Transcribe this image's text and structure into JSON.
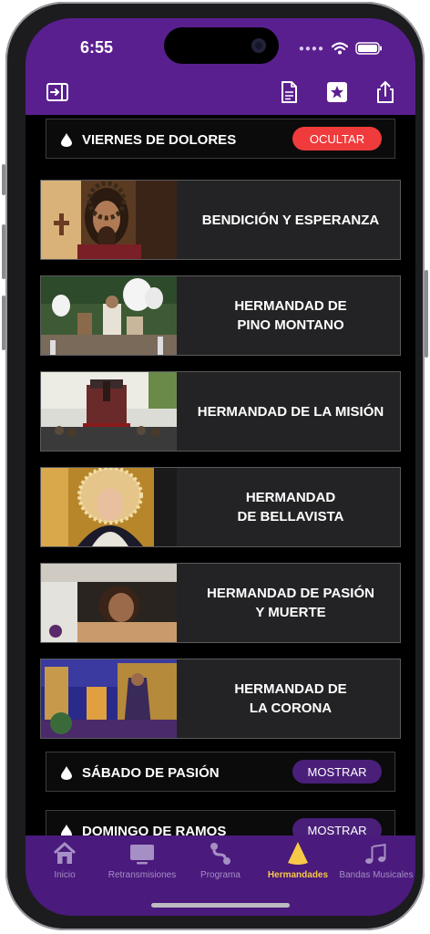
{
  "status": {
    "time": "6:55"
  },
  "toolbar": {
    "sidebar_icon": "sidebar-toggle-icon",
    "document_icon": "document-icon",
    "favorites_icon": "star-square-icon",
    "share_icon": "share-icon"
  },
  "sections": [
    {
      "title": "VIERNES DE DOLORES",
      "button": "OCULTAR",
      "state": "expanded"
    },
    {
      "title": "SÁBADO DE PASIÓN",
      "button": "MOSTRAR",
      "state": "collapsed"
    },
    {
      "title": "DOMINGO DE RAMOS",
      "button": "MOSTRAR",
      "state": "collapsed"
    }
  ],
  "hermandades": [
    {
      "name": "BENDICIÓN Y ESPERANZA"
    },
    {
      "name": "HERMANDAD DE\nPINO MONTANO"
    },
    {
      "name": "HERMANDAD DE LA MISIÓN"
    },
    {
      "name": "HERMANDAD\nDE BELLAVISTA"
    },
    {
      "name": "HERMANDAD DE PASIÓN\nY MUERTE"
    },
    {
      "name": "HERMANDAD DE\nLA CORONA"
    }
  ],
  "tabs": [
    {
      "label": "Inicio",
      "icon": "home-icon"
    },
    {
      "label": "Retransmisiones",
      "icon": "tv-icon"
    },
    {
      "label": "Programa",
      "icon": "route-icon"
    },
    {
      "label": "Hermandades",
      "icon": "capirote-icon",
      "active": true
    },
    {
      "label": "Bandas Musicales",
      "icon": "music-notes-icon"
    }
  ],
  "colors": {
    "brand": "#5a1f8f",
    "tabbar": "#4a1a7c",
    "active_tab": "#f7c948",
    "hide_button": "#ef3b3b",
    "show_button": "#4a1f7a"
  }
}
